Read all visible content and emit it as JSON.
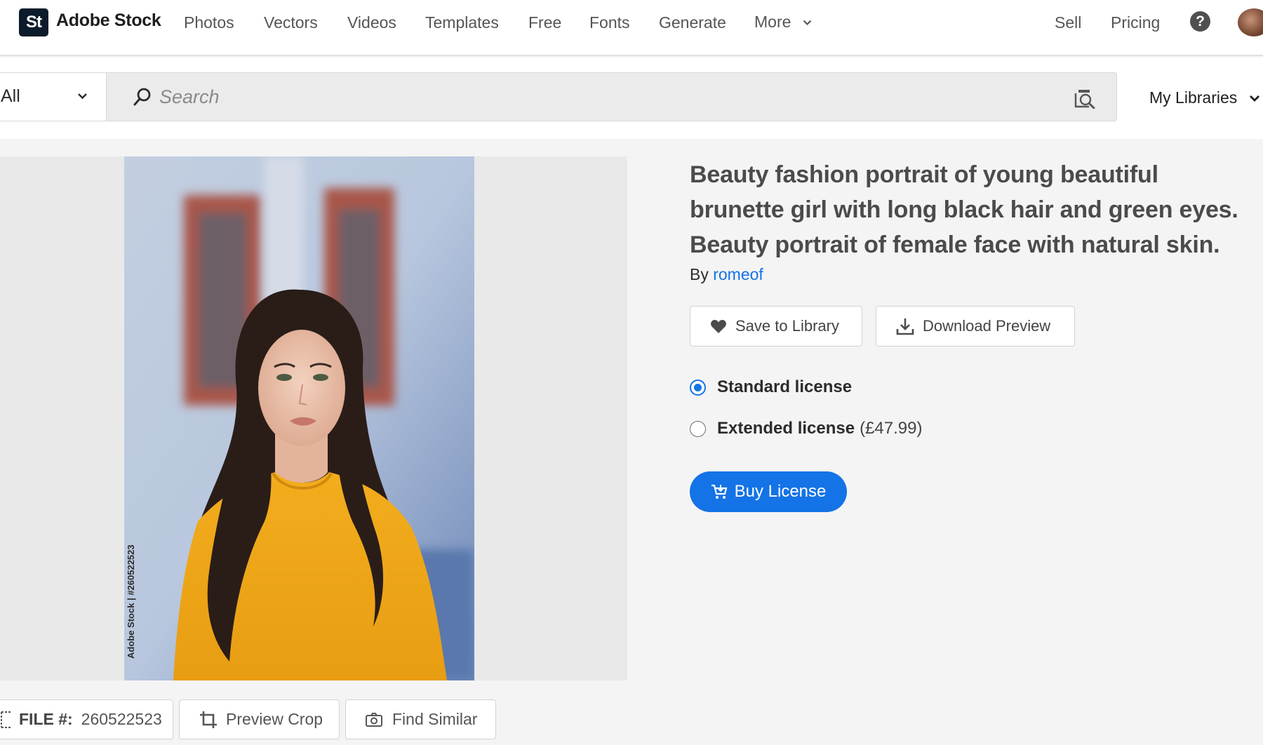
{
  "brand": {
    "badge": "St",
    "name": "Adobe Stock"
  },
  "nav": {
    "items": [
      "Photos",
      "Vectors",
      "Videos",
      "Templates",
      "Free",
      "Fonts",
      "Generate"
    ],
    "more_label": "More",
    "sell_label": "Sell",
    "pricing_label": "Pricing",
    "help_glyph": "?"
  },
  "search": {
    "scope_value": "All",
    "placeholder": "Search"
  },
  "my_libraries_label": "My Libraries",
  "asset": {
    "title": "Beauty fashion portrait of young beautiful brunette girl with long black hair and green eyes. Beauty portrait of female face with natural skin.",
    "by_prefix": "By",
    "author": "romeof",
    "watermark": "Adobe Stock | #260522523",
    "file_label": "FILE #:",
    "file_number": "260522523"
  },
  "actions": {
    "save_to_library": "Save to Library",
    "download_preview": "Download Preview",
    "preview_crop": "Preview Crop",
    "find_similar": "Find Similar"
  },
  "licenses": {
    "standard_label": "Standard license",
    "extended_label": "Extended license",
    "extended_price": "(£47.99)",
    "selected": "standard"
  },
  "buy_label": "Buy License",
  "colors": {
    "accent": "#1473e6",
    "logo_bg": "#0c1b2b"
  }
}
